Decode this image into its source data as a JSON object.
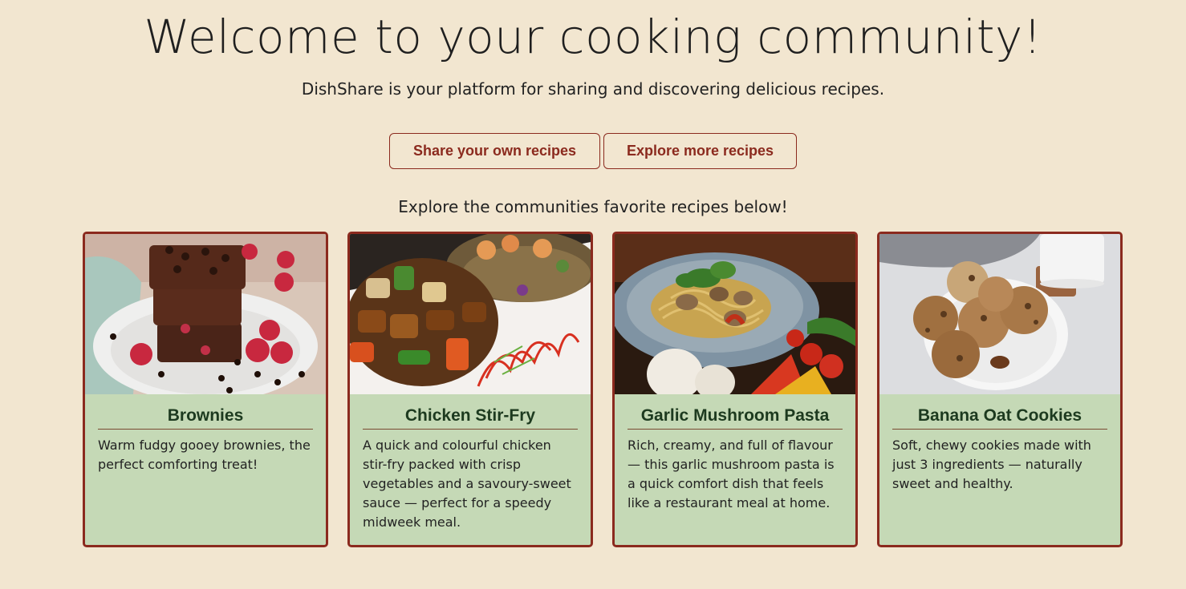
{
  "hero": {
    "title": "Welcome to your cooking community!",
    "subtitle": "DishShare is your platform for sharing and discovering delicious recipes."
  },
  "actions": {
    "share_label": "Share your own recipes",
    "explore_label": "Explore more recipes"
  },
  "section": {
    "heading": "Explore the communities favorite recipes below!"
  },
  "colors": {
    "background": "#f2e6d0",
    "accent": "#8b2a1e",
    "card_background": "#c5d9b6",
    "card_title": "#1d3a1f"
  },
  "recipes": [
    {
      "title": "Brownies",
      "description": "Warm fudgy gooey brownies, the perfect comforting treat!",
      "image": "brownies-photo"
    },
    {
      "title": "Chicken Stir-Fry",
      "description": "A quick and colourful chicken stir-fry packed with crisp vegetables and a savoury-sweet sauce — perfect for a speedy midweek meal.",
      "image": "stir-fry-photo"
    },
    {
      "title": "Garlic Mushroom Pasta",
      "description": "Rich, creamy, and full of flavour — this garlic mushroom pasta is a quick comfort dish that feels like a restaurant meal at home.",
      "image": "pasta-photo"
    },
    {
      "title": "Banana Oat Cookies",
      "description": "Soft, chewy cookies made with just 3 ingredients — naturally sweet and healthy.",
      "image": "cookies-photo"
    }
  ]
}
